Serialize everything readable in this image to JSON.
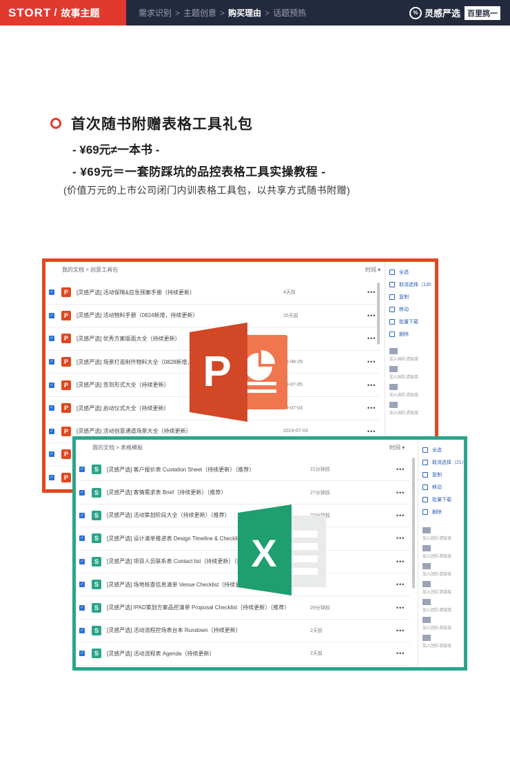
{
  "header": {
    "brand": "STORT",
    "section": "故事主题",
    "crumbs": [
      "需求识别",
      "主题创意",
      "购买理由",
      "话题预热"
    ],
    "active_crumb_index": 2,
    "right_brand_mark": "%",
    "right_brand_name": "灵感严选",
    "right_badge": "百里挑一"
  },
  "headline": {
    "title": "首次随书附赠表格工具礼包",
    "line1": "- ¥69元≠一本书 -",
    "line2": "- ¥69元＝一套防踩坑的品控表格工具实操教程 -",
    "note": "(价值万元的上市公司闭门内训表格工具包，以共享方式随书附赠)"
  },
  "ppt_panel": {
    "breadcrumb": "我的文档  >  创意工具包",
    "sort_label": "时间 ▾",
    "files": [
      {
        "name": "[灵感严选] 活动保障&应急预案手册（持续更新）",
        "time": "4天前"
      },
      {
        "name": "[灵感严选] 活动物料手册（0824新增，持续更新）",
        "time": "15天前"
      },
      {
        "name": "[灵感严选] 优秀方案版面大全（持续更新）",
        "time": "前"
      },
      {
        "name": "[灵感严选] 场景打造制作物料大全（0828新增，持续",
        "time": "19-08-29"
      },
      {
        "name": "[灵感严选] 签到形式大全（持续更新）",
        "time": "19-07-05"
      },
      {
        "name": "[灵感严选] 启动仪式大全（持续更新）",
        "time": "19-07-03"
      },
      {
        "name": "[灵感严选] 活动创意通道场景大全（持续更新）",
        "time": "2019-07-03"
      },
      {
        "name": "",
        "time": ""
      },
      {
        "name": "",
        "time": ""
      }
    ],
    "side_actions": [
      "全选",
      "取消选择（130",
      "复制",
      "移动",
      "批量下载",
      "删除"
    ],
    "side_users": [
      "加入国队请链接",
      "加入国队请链接",
      "加入国队请链接",
      "加入国队请链接"
    ]
  },
  "xls_panel": {
    "breadcrumb": "我的文档  >  表格模板",
    "sort_label": "时间 ▾",
    "files": [
      {
        "name": "[灵感严选] 客户报价表 Cuotation Sheet（持续更新）（推荐）",
        "time": "21分钟前"
      },
      {
        "name": "[灵感严选] 客情需求表 Brief（持续更新）（推荐）",
        "time": "27分钟前"
      },
      {
        "name": "[灵感严选] 活动策划阶段大全（持续更新）（推荐）",
        "time": "27分钟前"
      },
      {
        "name": "[灵感严选] 设计清单推进表 Design Timeline & Checklist（持",
        "time": ""
      },
      {
        "name": "[灵感严选] 项目人员联系表 Contact list（持续更新）（推荐）",
        "time": ""
      },
      {
        "name": "[灵感严选] 场地核查信息清单 Venue Checklist（持续更新）",
        "time": ""
      },
      {
        "name": "[灵感严选] IPAD策划方案品控清单 Proposal Checklist（持续更新）（推荐）",
        "time": "29分钟前"
      },
      {
        "name": "[灵感严选] 活动流程控场表台本 Rundown（持续更新）",
        "time": "2天前"
      },
      {
        "name": "[灵感严选] 活动流程表 Agenda（持续更新）",
        "time": "2天前"
      }
    ],
    "side_actions": [
      "全选",
      "取消选择（21）",
      "复制",
      "移动",
      "批量下载",
      "删除"
    ],
    "side_users": [
      "加入团队请链接",
      "加入团队请链接",
      "加入团队请链接",
      "加入团队请链接",
      "加入团队请链接",
      "加入团队请链接",
      "加入团队请链接"
    ]
  },
  "colors": {
    "ppt_accent": "#e0481f",
    "xls_accent": "#2aa58a",
    "brand_red": "#e2392f",
    "header_bg": "#242a3d"
  },
  "icons": {
    "ppt_file": "powerpoint-icon",
    "xls_file": "excel-icon",
    "more": "more-icon",
    "bullet": "ring-icon"
  }
}
